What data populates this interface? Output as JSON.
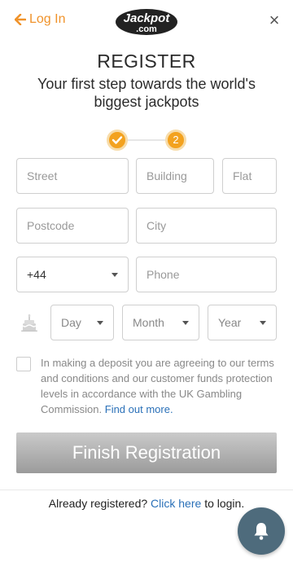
{
  "header": {
    "login_label": "Log In",
    "logo_text_top": "Jackpot",
    "logo_text_bottom": ".com",
    "close_symbol": "×"
  },
  "page": {
    "title": "REGISTER",
    "subtitle": "Your first step towards the world's biggest jackpots"
  },
  "steps": {
    "current": 2,
    "items": [
      {
        "state": "done",
        "icon": "check-icon"
      },
      {
        "state": "active",
        "label": "2"
      }
    ]
  },
  "address": {
    "street_placeholder": "Street",
    "building_placeholder": "Building",
    "flat_placeholder": "Flat",
    "postcode_placeholder": "Postcode",
    "city_placeholder": "City"
  },
  "phone": {
    "country_code": "+44",
    "phone_placeholder": "Phone"
  },
  "dob": {
    "icon": "birthday-cake-icon",
    "day_label": "Day",
    "month_label": "Month",
    "year_label": "Year"
  },
  "consent": {
    "text": "In making a deposit you are agreeing to our terms and conditions and our customer funds protection levels in accordance with the UK Gambling Commission.",
    "link_text": "Find out more."
  },
  "actions": {
    "finish_label": "Finish Registration"
  },
  "footer": {
    "already_text": "Already registered?",
    "click_here": "Click here",
    "to_login": "to login."
  },
  "colors": {
    "accent_orange": "#f0932b",
    "link_blue": "#2a70b8",
    "bell_bg": "#4e6b7c",
    "button_gray": "#b0b0b0"
  }
}
